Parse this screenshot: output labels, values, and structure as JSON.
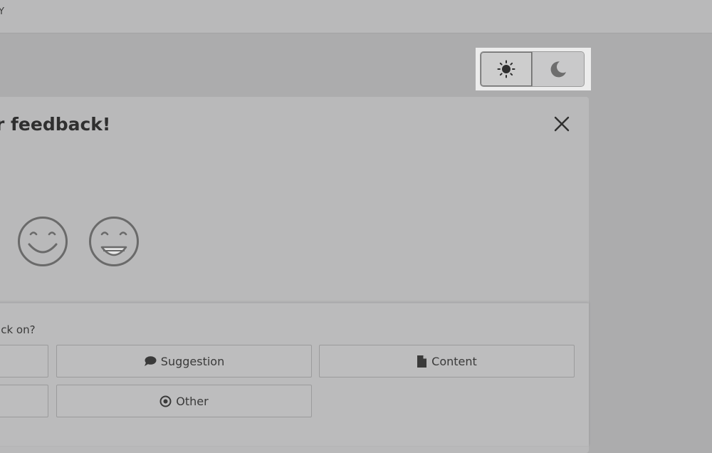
{
  "topbar": {
    "text": "Y"
  },
  "theme_toggle": {
    "light_icon": "sun-icon",
    "dark_icon": "moon-icon",
    "selected": "light"
  },
  "modal": {
    "title": "r feedback!",
    "close_icon": "close-icon",
    "faces": [
      "smile-face-icon",
      "grin-face-icon"
    ],
    "question": "ack on?",
    "categories": [
      {
        "label": "",
        "icon": ""
      },
      {
        "label": "Suggestion",
        "icon": "speech-bubble-icon"
      },
      {
        "label": "Content",
        "icon": "document-icon"
      },
      {
        "label": "",
        "icon": ""
      },
      {
        "label": "Other",
        "icon": "target-icon"
      }
    ]
  },
  "colors": {
    "background": "#acacad",
    "modal": "#b9b9ba",
    "highlight": "#ececec",
    "text": "#333333"
  }
}
